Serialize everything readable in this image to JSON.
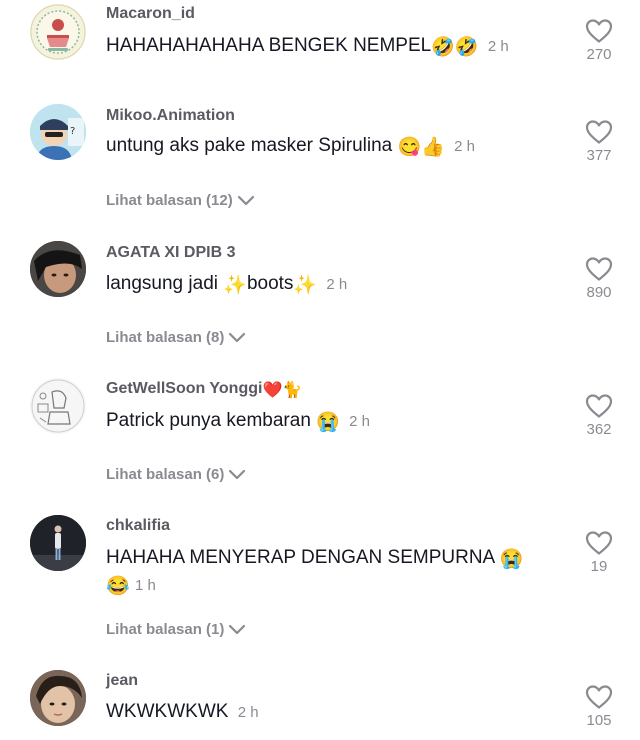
{
  "comments": [
    {
      "username": "Macaron_id",
      "text": "HAHAHAHAHAHA BENGEK NEMPEL",
      "emojis": [
        "🤣",
        "🤣"
      ],
      "time": "2 h",
      "likes": "270",
      "avatar": "bakery-logo-avatar"
    },
    {
      "username": "Mikoo.Animation",
      "text": "untung aks pake masker Spirulina",
      "emojis": [
        "😋",
        "👍"
      ],
      "time": "2 h",
      "likes": "377",
      "replies": "Lihat balasan (12)",
      "avatar": "cartoon-character-avatar"
    },
    {
      "username": "AGATA XI DPIB 3",
      "text_parts": [
        "langsung jadi",
        "boots"
      ],
      "emojis": [
        "✨",
        "✨"
      ],
      "time": "2 h",
      "likes": "890",
      "replies": "Lihat balasan (8)",
      "avatar": "person-photo-avatar"
    },
    {
      "username": "GetWellSoon Yonggi",
      "username_emojis": [
        "❤️",
        "🐈"
      ],
      "text": "Patrick punya kembaran",
      "emojis": [
        "😭"
      ],
      "time": "2 h",
      "likes": "362",
      "replies": "Lihat balasan (6)",
      "avatar": "sketch-drawing-avatar"
    },
    {
      "username": "chkalifia",
      "text": "HAHAHA MENYERAP DENGAN SEMPURNA",
      "emojis": [
        "😭",
        "😂"
      ],
      "time": "1 h",
      "likes": "19",
      "replies": "Lihat balasan (1)",
      "avatar": "standing-person-avatar"
    },
    {
      "username": "jean",
      "text": "WKWKWKWK",
      "time": "2 h",
      "likes": "105",
      "avatar": "face-photo-avatar"
    }
  ],
  "colors": {
    "username": "#5a5b62",
    "text": "#161823",
    "secondary": "#8a8b91",
    "heart_stroke": "#8a8b91",
    "background": "#ffffff"
  },
  "icons": {
    "like": "heart-outline-icon",
    "expand": "chevron-down-icon"
  }
}
